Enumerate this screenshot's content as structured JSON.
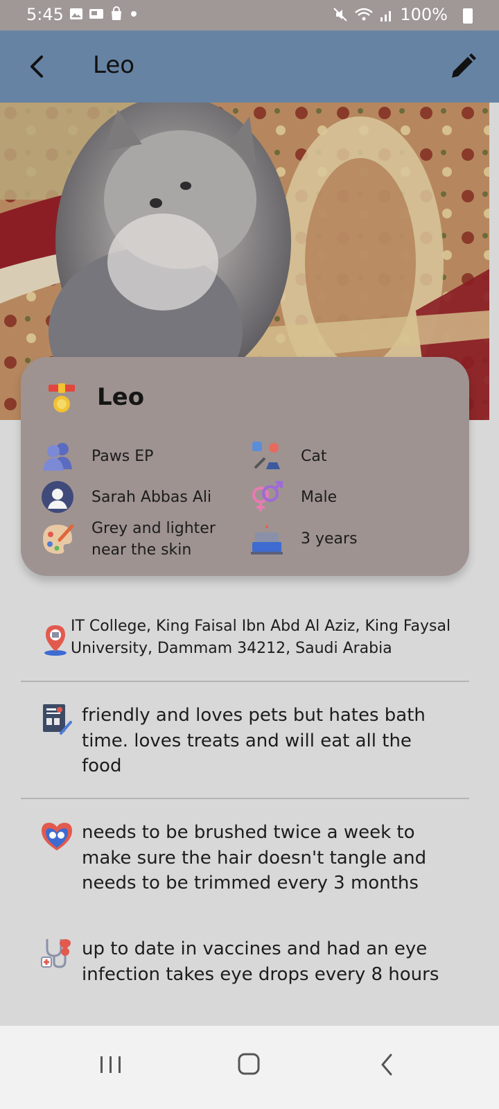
{
  "status_bar": {
    "time": "5:45",
    "battery": "100%",
    "icons_left": [
      "image-icon",
      "sim-icon",
      "bag-icon",
      "dot-icon"
    ],
    "icons_right": [
      "mute-icon",
      "wifi-icon",
      "signal-icon",
      "battery-icon"
    ]
  },
  "app_bar": {
    "title": "Leo",
    "back_icon": "back-arrow-icon",
    "edit_icon": "edit-pencil-icon",
    "background": "#6683a3"
  },
  "photo": {
    "subject": "pet-photo"
  },
  "card": {
    "name": "Leo",
    "name_icon": "medal-collar-icon",
    "attributes": [
      {
        "icon": "group-icon",
        "value": "Paws EP"
      },
      {
        "icon": "pet-type-icon",
        "value": "Cat"
      },
      {
        "icon": "owner-avatar-icon",
        "value": "Sarah Abbas Ali"
      },
      {
        "icon": "gender-icon",
        "value": "Male"
      },
      {
        "icon": "color-palette-icon",
        "value": "Grey and lighter near the skin"
      },
      {
        "icon": "birthday-cake-icon",
        "value": "3 years"
      }
    ],
    "background": "#9e9391"
  },
  "details": {
    "address": "IT College, King Faisal Ibn Abd Al Aziz, King Faysal University, Dammam 34212, Saudi Arabia",
    "personality": "friendly and loves pets but hates bath time. loves treats and will eat all the food",
    "care": "needs to be brushed twice a week to make sure the hair doesn't tangle and needs to be trimmed every 3 months",
    "medical": "up to date in vaccines and had an eye infection  takes eye drops every 8 hours"
  },
  "nav_bar": {
    "buttons": [
      "recents-icon",
      "home-icon",
      "back-icon"
    ]
  }
}
